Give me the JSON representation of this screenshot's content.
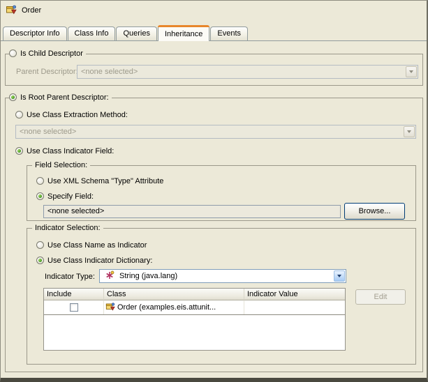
{
  "header": {
    "title": "Order",
    "icon": "descriptor-icon"
  },
  "tabs": {
    "items": [
      {
        "label": "Descriptor Info"
      },
      {
        "label": "Class Info"
      },
      {
        "label": "Queries"
      },
      {
        "label": "Inheritance"
      },
      {
        "label": "Events"
      }
    ],
    "active_tab": "Inheritance"
  },
  "child_descriptor": {
    "label": "Is Child Descriptor",
    "selected": false,
    "parent_descriptor_label": "Parent Descriptor:",
    "parent_descriptor_value": "<none selected>",
    "parent_descriptor_enabled": false
  },
  "root_descriptor": {
    "label": "Is Root Parent Descriptor:",
    "selected": true,
    "extraction": {
      "label": "Use Class Extraction Method:",
      "selected": false,
      "value": "<none selected>",
      "enabled": false
    },
    "indicator_field": {
      "label": "Use Class Indicator Field:",
      "selected": true
    }
  },
  "field_selection": {
    "title": "Field Selection:",
    "xml_attribute_label": "Use XML Schema \"Type\" Attribute",
    "xml_attribute_selected": false,
    "specify_field_label": "Specify Field:",
    "specify_field_selected": true,
    "field_value": "<none selected>",
    "browse_label": "Browse..."
  },
  "indicator_selection": {
    "title": "Indicator Selection:",
    "class_name_label": "Use Class Name as Indicator",
    "class_name_selected": false,
    "dictionary_label": "Use Class Indicator Dictionary:",
    "dictionary_selected": true,
    "indicator_type_label": "Indicator Type:",
    "indicator_type_value": "String (java.lang)",
    "indicator_type_icon": "string-type-icon",
    "table": {
      "columns": [
        "Include",
        "Class",
        "Indicator Value"
      ],
      "rows": [
        {
          "include_checked": false,
          "class_icon": "class-icon",
          "class_name": "Order (examples.eis.attunit...",
          "indicator_value": ""
        }
      ]
    },
    "edit_label": "Edit",
    "edit_enabled": false
  },
  "colors": {
    "window_bg": "#ECE9D8",
    "active_tab_accent": "#E8862B",
    "combo_border": "#7F9DB9",
    "disabled_text": "#9D9A8B",
    "radio_dot": "#3F9421",
    "default_button_border": "#003C74"
  }
}
